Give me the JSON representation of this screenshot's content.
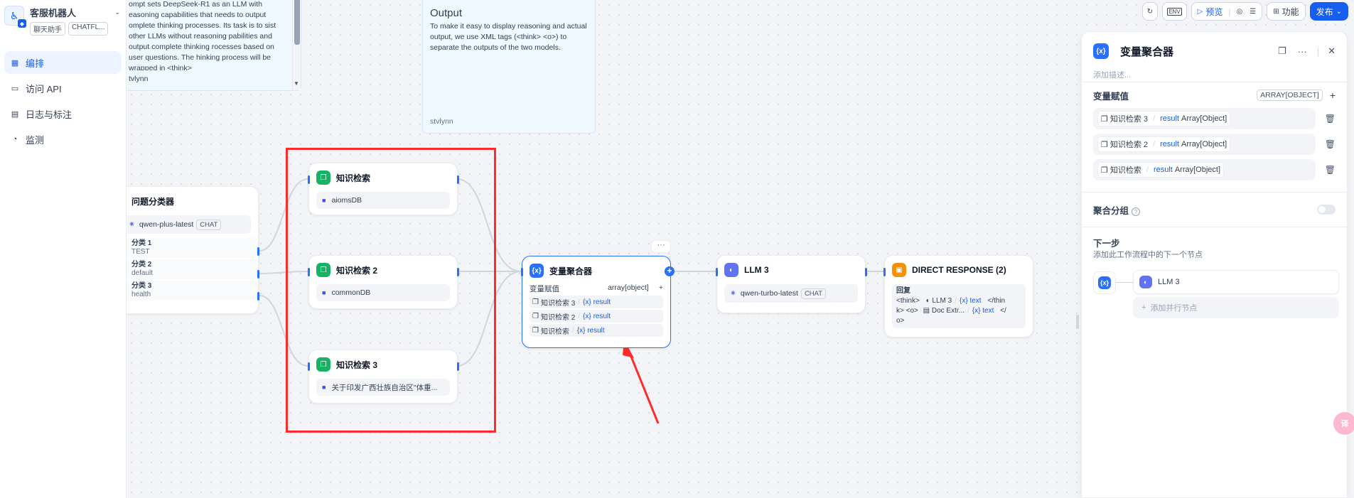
{
  "app": {
    "name": "客服机器人",
    "tags": [
      "聊天助手",
      "CHATFL..."
    ]
  },
  "nav": [
    {
      "label": "编排",
      "active": true,
      "icon": "layout-icon"
    },
    {
      "label": "访问 API",
      "icon": "terminal-icon"
    },
    {
      "label": "日志与标注",
      "icon": "log-icon"
    },
    {
      "label": "监测",
      "icon": "monitor-icon"
    }
  ],
  "notes": {
    "left": {
      "text": "ompt sets DeepSeek-R1 as an LLM with easoning capabilities that needs to output omplete thinking processes. Its task is to sist other LLMs without reasoning pabilities and output complete thinking rocesses based on user questions. The hinking process will be wrapped in <think>",
      "author": "tvlynn"
    },
    "output": {
      "title": "Output",
      "text": "To make it easy to display reasoning and actual output, we use XML tags (<think> <o>) to separate the outputs of the two models.",
      "author": "stvlynn"
    }
  },
  "classifier": {
    "title": "问题分类器",
    "model": "qwen-plus-latest",
    "model_tag": "CHAT",
    "classes": [
      {
        "name": "分类 1",
        "desc": "TEST"
      },
      {
        "name": "分类 2",
        "desc": "default"
      },
      {
        "name": "分类 3",
        "desc": "health"
      }
    ]
  },
  "kr1": {
    "title": "知识检索",
    "dataset": "aiomsDB"
  },
  "kr2": {
    "title": "知识检索 2",
    "dataset": "commonDB"
  },
  "kr3": {
    "title": "知识检索 3",
    "dataset": "关于印发广西壮族自治区\"体重..."
  },
  "aggregator": {
    "title": "变量聚合器",
    "head_label": "变量赋值",
    "head_type": "array[object]",
    "items": [
      {
        "node": "知识检索 3",
        "var": "result"
      },
      {
        "node": "知识检索 2",
        "var": "result"
      },
      {
        "node": "知识检索",
        "var": "result"
      }
    ]
  },
  "llm3": {
    "title": "LLM 3",
    "model": "qwen-turbo-latest",
    "model_tag": "CHAT"
  },
  "direct": {
    "title": "DIRECT RESPONSE (2)",
    "label": "回复",
    "line1_a": "<think>",
    "line1_node": "LLM 3",
    "line1_var": "text",
    "line1_b": "</thin",
    "line2_a": "k> <o>",
    "line2_node": "Doc Extr...",
    "line2_var": "text",
    "line2_b": "</",
    "line3": "o>"
  },
  "toolbar": {
    "env": "ENV",
    "preview": "预览",
    "features": "功能",
    "publish": "发布"
  },
  "panel": {
    "title": "变量聚合器",
    "desc_placeholder": "添加描述...",
    "vars_label": "变量赋值",
    "vars_type": "ARRAY[OBJECT]",
    "vars": [
      {
        "node": "知识检索 3",
        "var": "result",
        "type": "Array[Object]"
      },
      {
        "node": "知识检索 2",
        "var": "result",
        "type": "Array[Object]"
      },
      {
        "node": "知识检索",
        "var": "result",
        "type": "Array[Object]"
      }
    ],
    "group_label": "聚合分组",
    "next_label": "下一步",
    "next_desc": "添加此工作流程中的下一个节点",
    "next_node": "LLM 3",
    "add_parallel": "添加并行节点"
  },
  "floating": "译",
  "colors": {
    "accent": "#155eef",
    "highlight_frame": "#ff2b2b",
    "knowledge_icon": "#16b364"
  }
}
